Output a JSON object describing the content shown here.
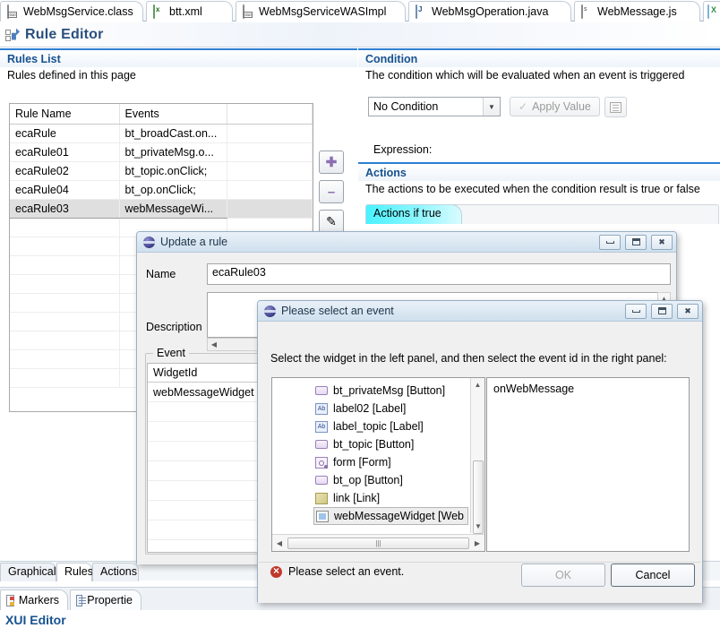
{
  "editor_tabs": [
    {
      "label": "WebMsgService.class",
      "icon": "class-file-icon",
      "active": false
    },
    {
      "label": "btt.xml",
      "icon": "xml-file-icon",
      "active": false
    },
    {
      "label": "WebMsgServiceWASImpl",
      "icon": "class-file-icon",
      "active": false
    },
    {
      "label": "WebMsgOperation.java",
      "icon": "java-file-icon",
      "active": false
    },
    {
      "label": "WebMessage.js",
      "icon": "js-file-icon",
      "active": false
    },
    {
      "label": "",
      "icon": "xls-file-icon",
      "active": false
    }
  ],
  "form_header": {
    "title": "Rule Editor",
    "icon": "rule-editor-icon"
  },
  "rules_list": {
    "section_title": "Rules List",
    "section_desc": "Rules defined in this page",
    "columns": [
      "Rule Name",
      "Events",
      ""
    ],
    "rows": [
      {
        "name": "ecaRule",
        "events": "bt_broadCast.on...",
        "selected": false
      },
      {
        "name": "ecaRule01",
        "events": "bt_privateMsg.o...",
        "selected": false
      },
      {
        "name": "ecaRule02",
        "events": "bt_topic.onClick;",
        "selected": false
      },
      {
        "name": "ecaRule04",
        "events": "bt_op.onClick;",
        "selected": false
      },
      {
        "name": "ecaRule03",
        "events": "webMessageWi...",
        "selected": true
      }
    ],
    "buttons": [
      {
        "name": "add-rule-button",
        "glyph": "✚"
      },
      {
        "name": "remove-rule-button",
        "glyph": "–"
      },
      {
        "name": "edit-rule-button",
        "glyph": "✎"
      },
      {
        "name": "move-up-button",
        "glyph": "⇧"
      }
    ]
  },
  "condition": {
    "section_title": "Condition",
    "section_desc": "The condition which will be evaluated when an event is triggered",
    "dropdown_value": "No Condition",
    "apply_value_label": "Apply Value",
    "expression_label": "Expression:"
  },
  "actions": {
    "section_title": "Actions",
    "section_desc": "The actions to be executed when the condition result is true or false",
    "tabs": [
      {
        "label": "Actions if true",
        "active": true
      }
    ]
  },
  "bottom_tabs": [
    {
      "label": "Graphical",
      "active": false
    },
    {
      "label": "Rules",
      "active": true
    },
    {
      "label": "Actions",
      "active": false
    }
  ],
  "view_tabs": [
    {
      "label": "Markers",
      "icon": "markers-icon",
      "active": true
    },
    {
      "label": "Propertie",
      "icon": "properties-icon",
      "active": false
    }
  ],
  "xui_editor_label": "XUI Editor",
  "update_rule_dialog": {
    "title": "Update a rule",
    "name_label": "Name",
    "name_value": "ecaRule03",
    "description_label": "Description",
    "description_value": "",
    "event_group_label": "Event",
    "event_columns": [
      "WidgetId"
    ],
    "event_rows": [
      "webMessageWidget"
    ],
    "window_buttons": [
      "minimize",
      "maximize",
      "close"
    ]
  },
  "select_event_dialog": {
    "title": "Please select an event",
    "instruction": "Select the widget in the left panel, and then select the event id in the right panel:",
    "widgets": [
      {
        "label": "bt_privateMsg [Button]",
        "icon": "button-icon",
        "selected": false
      },
      {
        "label": "label02 [Label]",
        "icon": "label-icon",
        "selected": false
      },
      {
        "label": "label_topic [Label]",
        "icon": "label-icon",
        "selected": false
      },
      {
        "label": "bt_topic [Button]",
        "icon": "button-icon",
        "selected": false
      },
      {
        "label": "form [Form]",
        "icon": "form-icon",
        "selected": false
      },
      {
        "label": "bt_op [Button]",
        "icon": "button-icon",
        "selected": false
      },
      {
        "label": "link [Link]",
        "icon": "link-icon",
        "selected": false
      },
      {
        "label": "webMessageWidget [Web",
        "icon": "widget-icon",
        "selected": true
      }
    ],
    "events": [
      "onWebMessage"
    ],
    "status_message": "Please select an event.",
    "ok_label": "OK",
    "cancel_label": "Cancel",
    "window_buttons": [
      "minimize",
      "maximize",
      "close"
    ]
  },
  "colors": {
    "section_accent": "#2d7fd1",
    "section_title": "#16528f",
    "selected_row": "#dfdfdf",
    "active_tab_gradient": "#49f2ff",
    "error": "#c0392b"
  }
}
